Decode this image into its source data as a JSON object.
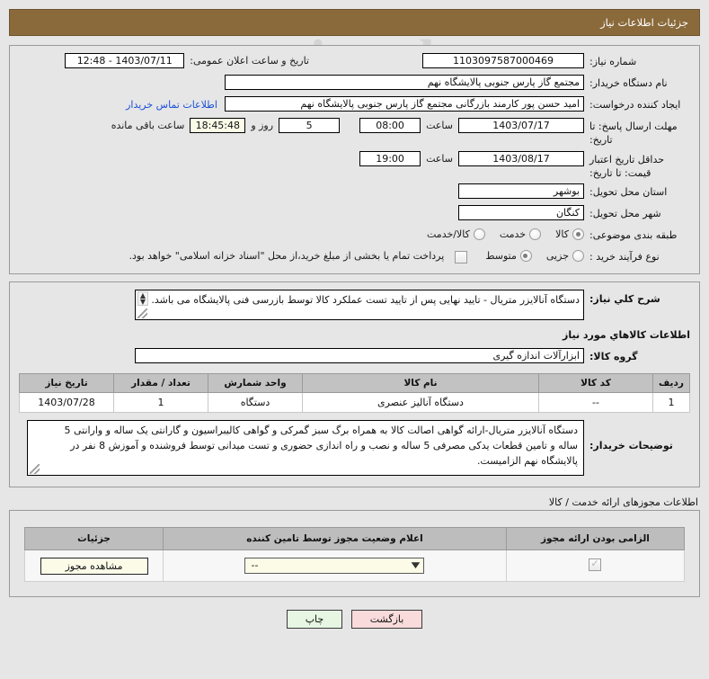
{
  "header": {
    "title": "جزئیات اطلاعات نیاز"
  },
  "form": {
    "need_number_label": "شماره نیاز:",
    "need_number_value": "1103097587000469",
    "announce_datetime_label": "تاریخ و ساعت اعلان عمومی:",
    "announce_datetime_value": "1403/07/11 - 12:48",
    "buyer_org_label": "نام دستگاه خریدار:",
    "buyer_org_value": "مجتمع گاز پارس جنوبی  پالایشگاه نهم",
    "requester_label": "ایجاد کننده درخواست:",
    "requester_value": "امید حسن پور کارمند بازرگانی مجتمع گاز پارس جنوبی  پالایشگاه نهم",
    "contact_link": "اطلاعات تماس خریدار",
    "reply_deadline_label": "مهلت ارسال پاسخ: تا تاریخ:",
    "reply_deadline_date": "1403/07/17",
    "time_label": "ساعت",
    "reply_deadline_time": "08:00",
    "remaining_days": "5",
    "days_and_label": "روز و",
    "remaining_clock": "18:45:48",
    "remaining_suffix": "ساعت باقی مانده",
    "price_validity_label": "حداقل تاریخ اعتبار قیمت: تا تاریخ:",
    "price_validity_date": "1403/08/17",
    "price_validity_time": "19:00",
    "province_label": "استان محل تحویل:",
    "province_value": "بوشهر",
    "city_label": "شهر محل تحویل:",
    "city_value": "کنگان",
    "category_label": "طبقه بندی موضوعی:",
    "category_options": [
      {
        "label": "کالا",
        "selected": true
      },
      {
        "label": "خدمت",
        "selected": false
      },
      {
        "label": "کالا/خدمت",
        "selected": false
      }
    ],
    "process_type_label": "نوع فرآیند خرید :",
    "process_type_options": [
      {
        "label": "جزیی",
        "selected": false
      },
      {
        "label": "متوسط",
        "selected": true
      }
    ],
    "treasury_checkbox_checked": false,
    "treasury_note": "پرداخت تمام یا بخشی از مبلغ خرید،از محل \"اسناد خزانه اسلامی\" خواهد بود."
  },
  "need_description": {
    "label": "شرح کلي نياز:",
    "value": "دستگاه آنالایزر متریال - تایید نهایی پس از تایید تست عملکرد کالا توسط بازرسی فنی پالایشگاه می باشد."
  },
  "goods_section": {
    "heading": "اطلاعات کالاهاي مورد نياز",
    "group_label": "گروه کالا:",
    "group_value": "ابزارآلات اندازه گیری",
    "table": {
      "columns": [
        "ردیف",
        "کد کالا",
        "نام کالا",
        "واحد شمارش",
        "تعداد / مقدار",
        "تاریخ نیاز"
      ],
      "rows": [
        [
          "1",
          "--",
          "دستگاه آنالیز عنصری",
          "دستگاه",
          "1",
          "1403/07/28"
        ]
      ]
    },
    "buyer_notes_label": "توضیحات خریدار:",
    "buyer_notes_value": "دستگاه آنالایزر متریال-ارائه گواهی اصالت کالا به همراه برگ سبز گمرکی و گواهی کالیبراسیون و گارانتی یک ساله و وارانتی 5 ساله و تامین قطعات یدکی مصرفی 5 ساله و نصب و راه اندازی حضوری و تست میدانی توسط فروشنده و آموزش 8 نفر در پالایشگاه نهم الزامیست."
  },
  "license_section": {
    "heading": "اطلاعات مجوزهای ارائه خدمت / کالا",
    "table": {
      "columns": [
        "الزامی بودن ارائه مجوز",
        "اعلام وضعیت مجوز توسط تامین کننده",
        "جزئیات"
      ],
      "rows": [
        {
          "required_checked": true,
          "status_value": "--",
          "details_button": "مشاهده مجوز"
        }
      ]
    }
  },
  "footer": {
    "print_label": "چاپ",
    "back_label": "بازگشت"
  },
  "watermark": {
    "line1": "tiratender.net",
    "line2": "itender.net"
  },
  "colors": {
    "title_bar": "#8a6a3b",
    "page_bg": "#e6e6e6",
    "link": "#1b4fd8",
    "table_header": "#c2c2c2",
    "print_btn": "#e6f6e2",
    "back_btn": "#fadbdb",
    "cream_field": "#fbfbe8"
  }
}
